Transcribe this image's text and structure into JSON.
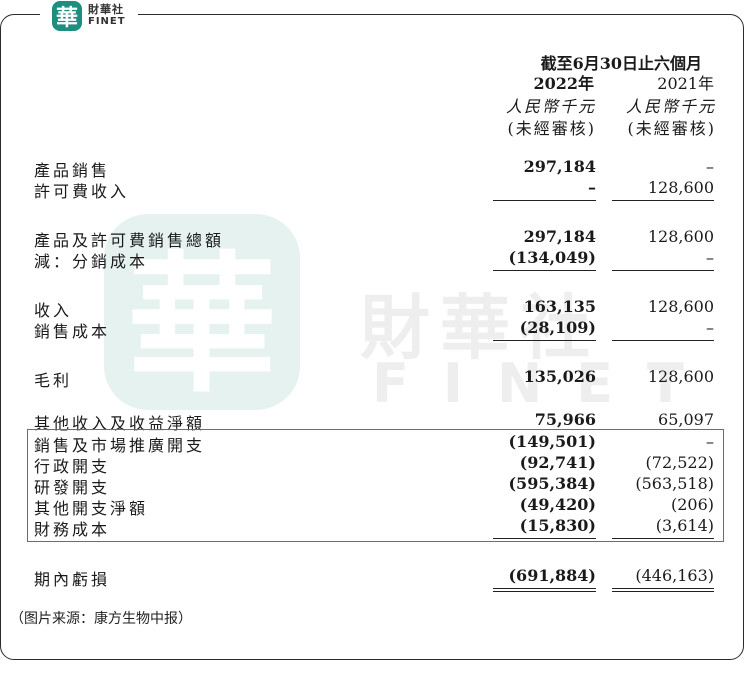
{
  "brand": {
    "badge_char": "華",
    "name_cn": "財華社",
    "name_en": "FINET"
  },
  "watermark": {
    "seal_char": "華",
    "name_cn": "財華社",
    "name_en": "FINET"
  },
  "header": {
    "period": "截至6月30日止六個月",
    "year_current": "2022年",
    "year_prior": "2021年",
    "currency_current": "人民幣千元",
    "currency_prior": "人民幣千元",
    "audit_current": "(未經審核)",
    "audit_prior": "(未經審核)"
  },
  "rows": [
    {
      "label": "產品銷售",
      "current": "297,184",
      "prior": "–"
    },
    {
      "label": "許可費收入",
      "current": "–",
      "prior": "128,600"
    },
    {
      "label": "產品及許可費銷售總額",
      "current": "297,184",
      "prior": "128,600"
    },
    {
      "label": "減：分銷成本",
      "current": "(134,049)",
      "prior": "–"
    },
    {
      "label": "收入",
      "current": "163,135",
      "prior": "128,600"
    },
    {
      "label": "銷售成本",
      "current": "(28,109)",
      "prior": "–"
    },
    {
      "label": "毛利",
      "current": "135,026",
      "prior": "128,600"
    },
    {
      "label": "其他收入及收益淨額",
      "current": "75,966",
      "prior": "65,097"
    },
    {
      "label": "銷售及市場推廣開支",
      "current": "(149,501)",
      "prior": "–"
    },
    {
      "label": "行政開支",
      "current": "(92,741)",
      "prior": "(72,522)"
    },
    {
      "label": "研發開支",
      "current": "(595,384)",
      "prior": "(563,518)"
    },
    {
      "label": "其他開支淨額",
      "current": "(49,420)",
      "prior": "(206)"
    },
    {
      "label": "財務成本",
      "current": "(15,830)",
      "prior": "(3,614)"
    },
    {
      "label": "期內虧損",
      "current": "(691,884)",
      "prior": "(446,163)"
    }
  ],
  "caption": "（图片来源：康方生物中报）",
  "colors": {
    "highlight": "#e53935",
    "brand": "#1e8e80"
  }
}
